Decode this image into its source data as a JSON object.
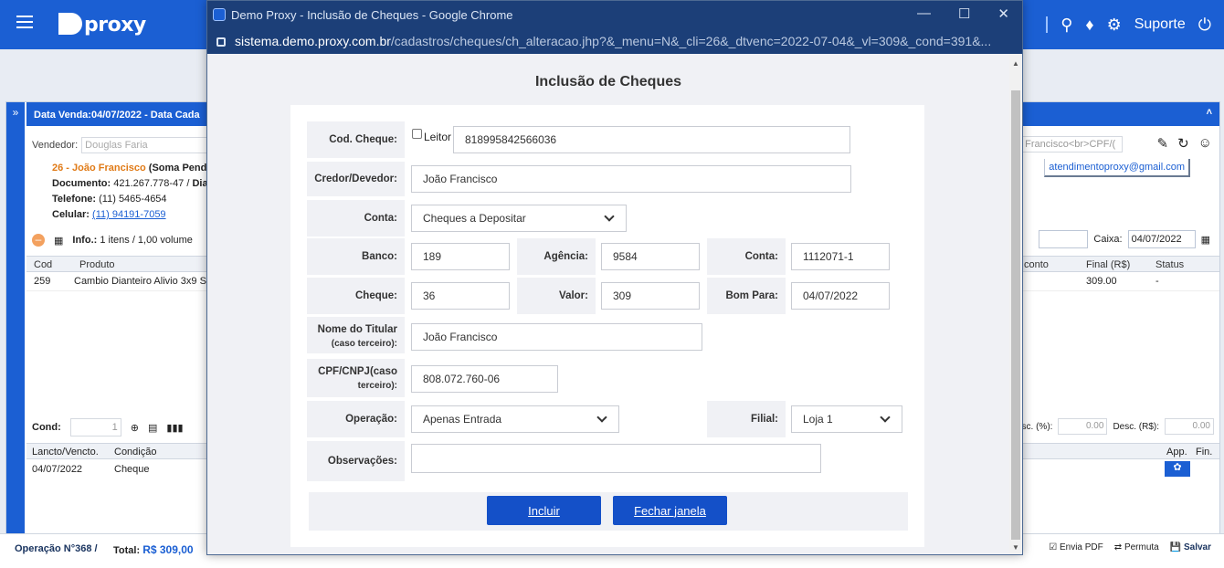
{
  "app": {
    "brand": "proxy",
    "support_label": "Suporte"
  },
  "background_panel": {
    "header": "Data Venda:04/07/2022 - Data Cada",
    "vendedor_label": "Vendedor:",
    "vendedor_placeholder": "Douglas Faria",
    "client_name": "26 - João Francisco",
    "client_note": "(Soma Pendê",
    "documento_label": "Documento:",
    "documento_value": "421.267.778-47 /",
    "dias_label": "Dias",
    "telefone_label": "Telefone:",
    "telefone_value": "(11) 5465-4654",
    "celular_label": "Celular:",
    "celular_value": "(11) 94191-7059",
    "search_hint": "o Francisco<br>CPF/(",
    "email": "atendimentoproxy@gmail.com",
    "info_label": "Info.:",
    "info_value": "1 itens / 1,00 volume",
    "caixa_label": "Caixa:",
    "caixa_value": "04/07/2022",
    "columns": [
      "Cod",
      "Produto",
      "conto",
      "Final (R$)",
      "Status"
    ],
    "row": {
      "cod": "259",
      "produto": "Cambio Dianteiro Alivio 3x9 S",
      "final": "309.00",
      "status": "-"
    },
    "cond_label": "Cond:",
    "cond_value": "1",
    "desc_pct_label": "sc. (%):",
    "desc_pct_value": "0.00",
    "desc_rs_label": "Desc. (R$):",
    "desc_rs_value": "0.00",
    "pay_columns": [
      "Lancto/Vencto.",
      "Condição",
      "App.",
      "Fin."
    ],
    "pay_row": {
      "date": "04/07/2022",
      "cond": "Cheque"
    },
    "operacao": "Operação N°368 /",
    "total_label": "Total:",
    "total_value": "R$ 309,00",
    "actions": [
      "Envia PDF",
      "Permuta",
      "Salvar"
    ]
  },
  "popup": {
    "window_title": "Demo Proxy - Inclusão de Cheques - Google Chrome",
    "url_host": "sistema.demo.proxy.com.br",
    "url_path": "/cadastros/cheques/ch_alteracao.jhp?&_menu=N&_cli=26&_dtvenc=2022-07-04&_vl=309&_cond=391&...",
    "heading": "Inclusão de Cheques",
    "cod_cheque_label": "Cod. Cheque:",
    "leitor_label": "Leitor",
    "cod_cheque_value": "818995842566036",
    "credor_label": "Credor/Devedor:",
    "credor_value": "João Francisco",
    "conta_label": "Conta:",
    "conta_value": "Cheques a Depositar",
    "banco_label": "Banco:",
    "banco_value": "189",
    "agencia_label": "Agência:",
    "agencia_value": "9584",
    "conta2_label": "Conta:",
    "conta2_value": "1112071-1",
    "cheque_label": "Cheque:",
    "cheque_value": "36",
    "valor_label": "Valor:",
    "valor_value": "309",
    "bom_para_label": "Bom Para:",
    "bom_para_value": "04/07/2022",
    "titular_label": "Nome do Titular",
    "titular_sub": "(caso terceiro):",
    "titular_value": "João Francisco",
    "cpf_label": "CPF/CNPJ(caso",
    "cpf_sub": "terceiro):",
    "cpf_value": "808.072.760-06",
    "operacao_label": "Operação:",
    "operacao_value": "Apenas Entrada",
    "filial_label": "Filial:",
    "filial_value": "Loja 1",
    "obs_label": "Observações:",
    "obs_value": "",
    "incluir_label": "Incluir",
    "fechar_label": "Fechar janela"
  }
}
